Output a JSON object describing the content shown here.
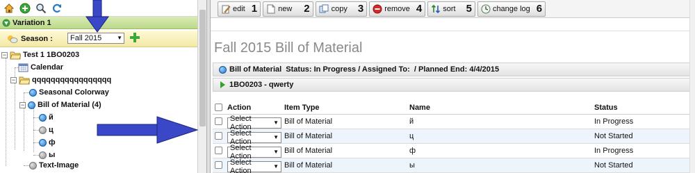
{
  "left_panel": {
    "topbar_icons": [
      "home-icon",
      "add-icon",
      "search-icon",
      "refresh-icon"
    ],
    "variation_label": "Variation 1",
    "season": {
      "label": "Season :",
      "selected": "Fall 2015"
    },
    "tree": [
      {
        "name": "tree-item-test1",
        "label": "Test 1   1BO0203",
        "type": "folder-open"
      },
      {
        "name": "tree-item-calendar",
        "label": "Calendar",
        "type": "calendar"
      },
      {
        "name": "tree-item-q-folder",
        "label": "qqqqqqqqqqqqqqqqq",
        "type": "folder-open"
      },
      {
        "name": "tree-item-seasonal-colorway",
        "label": "Seasonal Colorway",
        "type": "blue"
      },
      {
        "name": "tree-item-bill-of-material",
        "label": "Bill of Material (4)",
        "type": "blue"
      },
      {
        "name": "tree-item-bom-y",
        "label": "й",
        "type": "blue"
      },
      {
        "name": "tree-item-bom-ts",
        "label": "ц",
        "type": "gray"
      },
      {
        "name": "tree-item-bom-f",
        "label": "ф",
        "type": "blue"
      },
      {
        "name": "tree-item-bom-y2",
        "label": "ы",
        "type": "gray"
      },
      {
        "name": "tree-item-text-image",
        "label": "Text-Image",
        "type": "gray"
      }
    ]
  },
  "toolbar": {
    "buttons": [
      {
        "label": "edit",
        "num": "1",
        "icon": "edit-icon"
      },
      {
        "label": "new",
        "num": "2",
        "icon": "new-document-icon"
      },
      {
        "label": "copy",
        "num": "3",
        "icon": "copy-icon"
      },
      {
        "label": "remove",
        "num": "4",
        "icon": "remove-icon"
      },
      {
        "label": "sort",
        "num": "5",
        "icon": "sort-icon"
      },
      {
        "label": "change log",
        "num": "6",
        "icon": "change-log-icon"
      }
    ]
  },
  "main": {
    "title": "Fall 2015 Bill of Material",
    "bom_header": "Bill of Material  Status: In Progress / Assigned To:  / Planned End: 4/4/2015",
    "sub_header": "1BO0203 - qwerty",
    "table": {
      "columns": [
        "Action",
        "Item Type",
        "Name",
        "Status"
      ],
      "rows": [
        {
          "action": "Select Action",
          "item_type": "Bill of Material",
          "name": "й",
          "status": "In Progress"
        },
        {
          "action": "Select Action",
          "item_type": "Bill of Material",
          "name": "ц",
          "status": "Not Started"
        },
        {
          "action": "Select Action",
          "item_type": "Bill of Material",
          "name": "ф",
          "status": "In Progress"
        },
        {
          "action": "Select Action",
          "item_type": "Bill of Material",
          "name": "ы",
          "status": "Not Started"
        }
      ]
    }
  },
  "colors": {
    "variation_bar": "#c8e39a",
    "season_bar": "#f6eeb4",
    "annotation_arrow": "#3a48c8",
    "row_alt": "#eef4fb"
  }
}
